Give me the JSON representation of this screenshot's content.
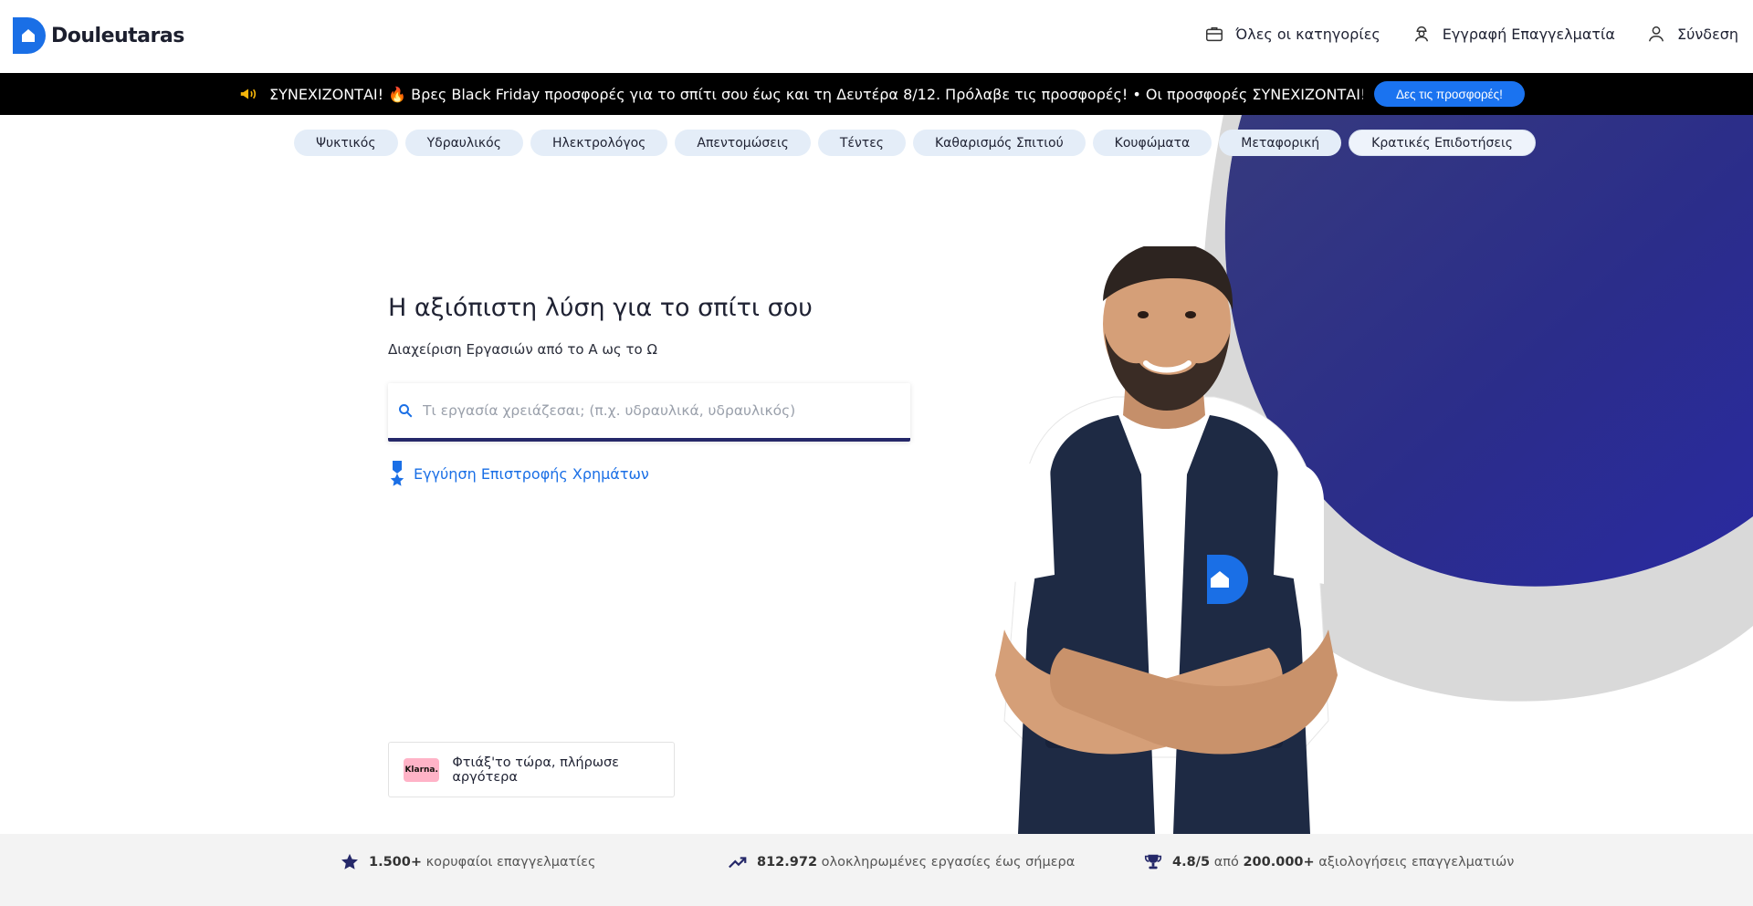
{
  "brand": {
    "name": "Douleutaras"
  },
  "nav": {
    "categories_label": "Όλες οι κατηγορίες",
    "register_pro_label": "Εγγραφή Επαγγελματία",
    "login_label": "Σύνδεση"
  },
  "promo": {
    "text": "ΣΥΝΕΧΙΖΟΝΤΑΙ! 🔥 Βρες Black Friday προσφορές για το σπίτι σου έως και τη Δευτέρα 8/12. Πρόλαβε τις προσφορές!  • Οι προσφορές ΣΥΝΕΧΙΖΟΝΤΑΙ! 🔥 Βρες Black Friday προσφορές για το σπίτι σου",
    "cta_label": "Δες τις προσφορές!",
    "accent": "#1a73f0"
  },
  "categories": [
    "Ψυκτικός",
    "Υδραυλικός",
    "Ηλεκτρολόγος",
    "Απεντομώσεις",
    "Τέντες",
    "Καθαρισμός Σπιτιού",
    "Κουφώματα",
    "Μεταφορική",
    "Κρατικές Επιδοτήσεις"
  ],
  "hero": {
    "title": "Η αξιόπιστη λύση για το σπίτι σου",
    "subtitle": "Διαχείριση Εργασιών από το Α ως το Ω",
    "search_placeholder": "Τι εργασία χρειάζεσαι; (π.χ. υδραυλικά, υδραυλικός)",
    "search_value": "",
    "guarantee_label": "Εγγύηση Επιστροφής Χρημάτων",
    "brand_color": "#252869"
  },
  "klarna": {
    "badge": "Klarna.",
    "text": "Φτιάξ'το τώρα, πλήρωσε αργότερα"
  },
  "stats": [
    {
      "icon": "star-icon",
      "value": "1.500+",
      "text": "κορυφαίοι επαγγελματίες"
    },
    {
      "icon": "trending-up-icon",
      "value": "812.972",
      "text": "ολοκληρωμένες εργασίες έως σήμερα"
    },
    {
      "icon": "trophy-icon",
      "value": "4.8/5",
      "text_mid": "από",
      "value2": "200.000+",
      "text": "αξιολογήσεις επαγγελματιών"
    }
  ]
}
